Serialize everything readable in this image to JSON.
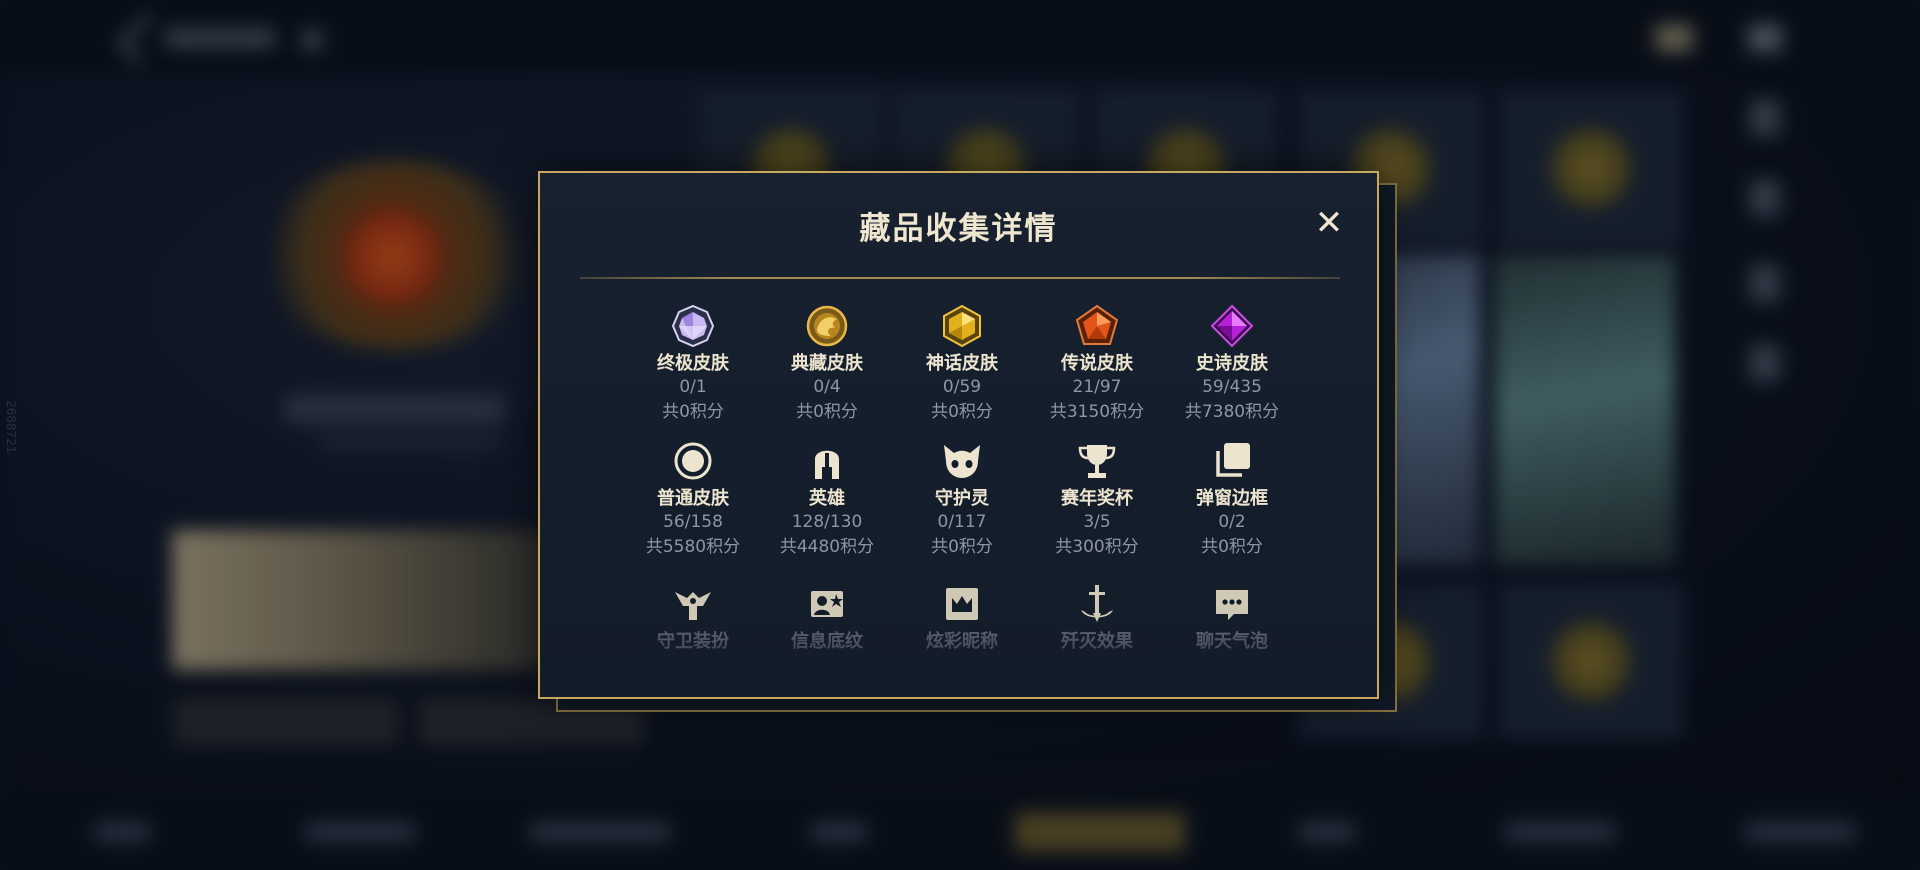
{
  "background": {
    "side_id": "2688721"
  },
  "modal": {
    "title": "藏品收集详情",
    "close_label": "✕",
    "row1": [
      {
        "id": "ultimate",
        "name": "终极皮肤",
        "count": "0/1",
        "points": "共0积分",
        "icon": "ultimate-gem-icon"
      },
      {
        "id": "collector",
        "name": "典藏皮肤",
        "count": "0/4",
        "points": "共0积分",
        "icon": "dragon-coin-icon"
      },
      {
        "id": "mythic",
        "name": "神话皮肤",
        "count": "0/59",
        "points": "共0积分",
        "icon": "gold-gem-icon"
      },
      {
        "id": "legendary",
        "name": "传说皮肤",
        "count": "21/97",
        "points": "共3150积分",
        "icon": "orange-gem-icon"
      },
      {
        "id": "epic",
        "name": "史诗皮肤",
        "count": "59/435",
        "points": "共7380积分",
        "icon": "purple-gem-icon"
      }
    ],
    "row2": [
      {
        "id": "normal",
        "name": "普通皮肤",
        "count": "56/158",
        "points": "共5580积分",
        "icon": "circle-icon"
      },
      {
        "id": "hero",
        "name": "英雄",
        "count": "128/130",
        "points": "共4480积分",
        "icon": "helmet-icon"
      },
      {
        "id": "guardian",
        "name": "守护灵",
        "count": "0/117",
        "points": "共0积分",
        "icon": "guardian-spirit-icon"
      },
      {
        "id": "trophy",
        "name": "赛年奖杯",
        "count": "3/5",
        "points": "共300积分",
        "icon": "trophy-icon"
      },
      {
        "id": "frame",
        "name": "弹窗边框",
        "count": "0/2",
        "points": "共0积分",
        "icon": "stacked-frames-icon"
      }
    ],
    "row3": [
      {
        "id": "guard-outfit",
        "name": "守卫装扮",
        "icon": "guard-statue-icon"
      },
      {
        "id": "info-bg",
        "name": "信息底纹",
        "icon": "profile-card-icon"
      },
      {
        "id": "nickname",
        "name": "炫彩昵称",
        "icon": "crown-badge-icon"
      },
      {
        "id": "kill-effect",
        "name": "歼灭效果",
        "icon": "sword-effect-icon"
      },
      {
        "id": "chat-bubble",
        "name": "聊天气泡",
        "icon": "chat-bubble-icon"
      }
    ]
  },
  "colors": {
    "accent_gold": "#c8a85e",
    "title_text": "#efe6cf",
    "muted_text": "#8e96a3"
  }
}
